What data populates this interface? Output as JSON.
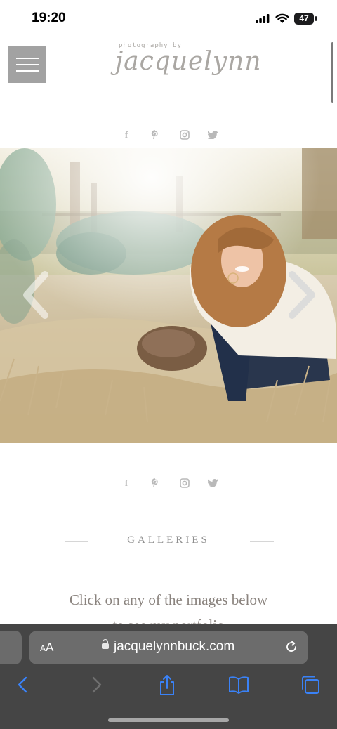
{
  "status_bar": {
    "time": "19:20",
    "battery": "47"
  },
  "site": {
    "logo_small": "photography by",
    "logo_name": "jacquelynn",
    "social_icons": [
      "facebook-icon",
      "pinterest-icon",
      "instagram-icon",
      "twitter-icon"
    ],
    "galleries_heading": "GALLERIES",
    "intro_line1": "Click on any of the images below",
    "intro_line2": "to see my portfolio"
  },
  "browser": {
    "aa_label": "AA",
    "url": "jacquelynnbuck.com",
    "accent": "#3a82f7"
  }
}
